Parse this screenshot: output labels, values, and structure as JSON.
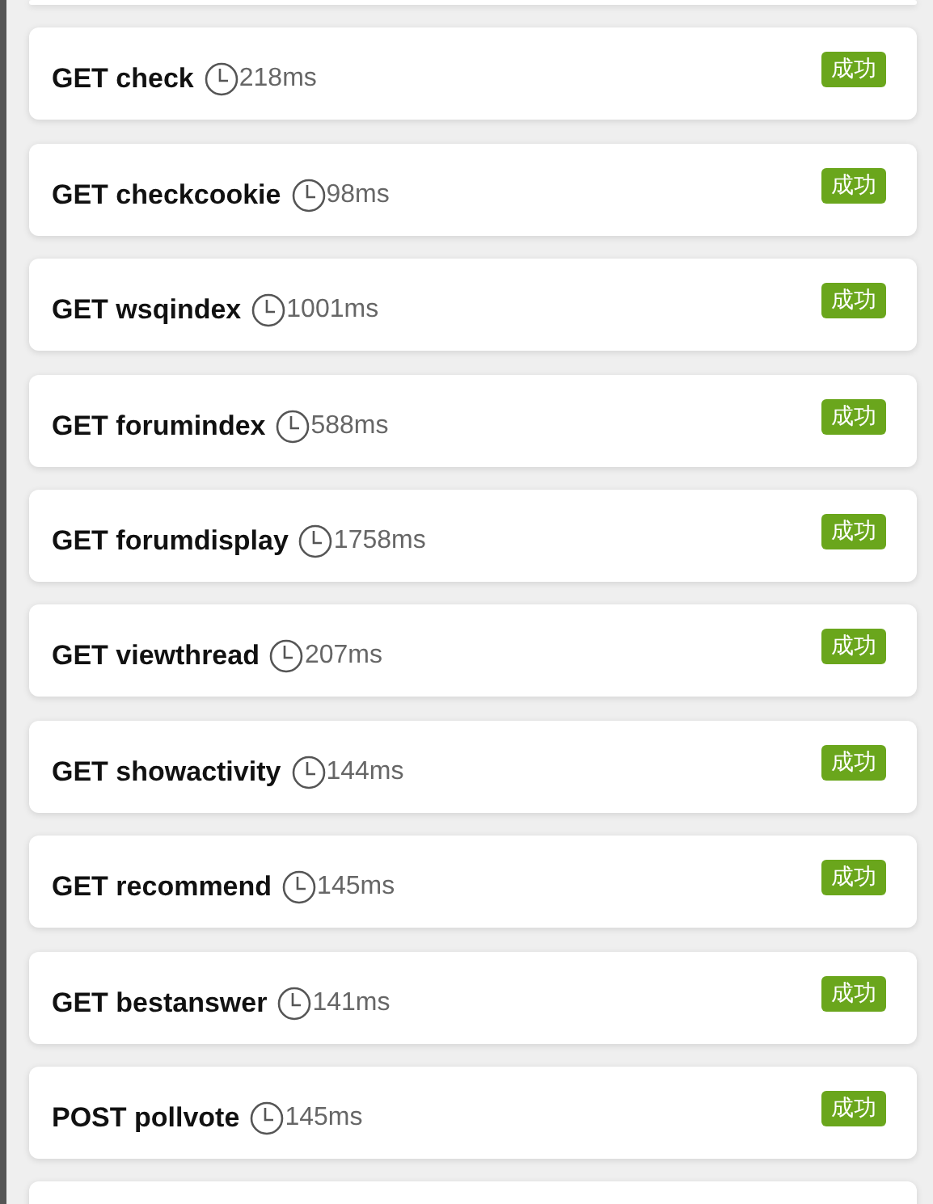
{
  "requests": [
    {
      "method": "GET",
      "name": "check",
      "time": "218ms",
      "status": "成功"
    },
    {
      "method": "GET",
      "name": "checkcookie",
      "time": "98ms",
      "status": "成功"
    },
    {
      "method": "GET",
      "name": "wsqindex",
      "time": "1001ms",
      "status": "成功"
    },
    {
      "method": "GET",
      "name": "forumindex",
      "time": "588ms",
      "status": "成功"
    },
    {
      "method": "GET",
      "name": "forumdisplay",
      "time": "1758ms",
      "status": "成功"
    },
    {
      "method": "GET",
      "name": "viewthread",
      "time": "207ms",
      "status": "成功"
    },
    {
      "method": "GET",
      "name": "showactivity",
      "time": "144ms",
      "status": "成功"
    },
    {
      "method": "GET",
      "name": "recommend",
      "time": "145ms",
      "status": "成功"
    },
    {
      "method": "GET",
      "name": "bestanswer",
      "time": "141ms",
      "status": "成功"
    },
    {
      "method": "POST",
      "name": "pollvote",
      "time": "145ms",
      "status": "成功"
    }
  ]
}
